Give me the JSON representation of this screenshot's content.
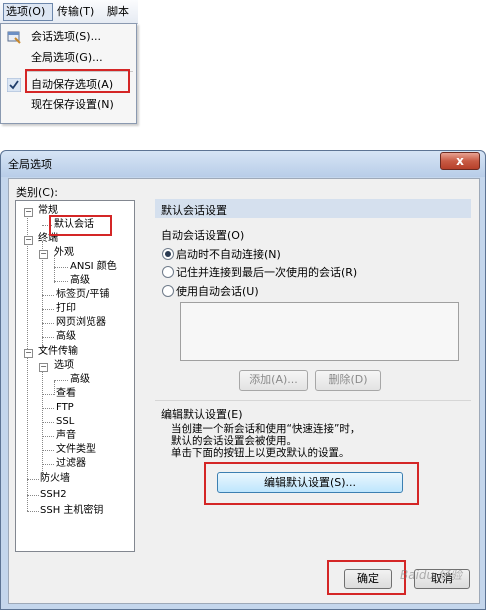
{
  "menubar": {
    "items": [
      "选项(O)",
      "传输(T)",
      "脚本(S"
    ]
  },
  "menu": {
    "items": [
      "会话选项(S)...",
      "全局选项(G)...",
      "自动保存选项(A)",
      "现在保存设置(N)"
    ]
  },
  "dialog": {
    "title": "全局选项",
    "close_label": "x",
    "category_label": "类别(C):",
    "tree": [
      "常规",
      "默认会话",
      "终端",
      "外观",
      "ANSI 颜色",
      "高级",
      "标签页/平铺",
      "打印",
      "网页浏览器",
      "高级",
      "文件传输",
      "选项",
      "高级",
      "查看",
      "FTP",
      "SSL",
      "声音",
      "文件类型",
      "过滤器",
      "防火墙",
      "SSH2",
      "SSH 主机密钥"
    ],
    "panel_title": "默认会话设置",
    "auto_group_label": "自动会话设置(O)",
    "radios": [
      "启动时不自动连接(N)",
      "记住并连接到最后一次使用的会话(R)",
      "使用自动会话(U)"
    ],
    "add_button": "添加(A)...",
    "delete_button": "删除(D)",
    "edit_group_label": "编辑默认设置(E)",
    "description": [
      "当创建一个新会话和使用“快速连接”时，",
      "默认的会话设置会被使用。",
      "单击下面的按钮上以更改默认的设置。"
    ],
    "edit_button": "编辑默认设置(S)...",
    "ok_button": "确定",
    "cancel_button": "取消"
  },
  "watermark": "Baidu 经验",
  "colors": {
    "highlight_box": "#d42626",
    "panel_header": "#d5e0ee",
    "close_button": "#c85b44"
  }
}
